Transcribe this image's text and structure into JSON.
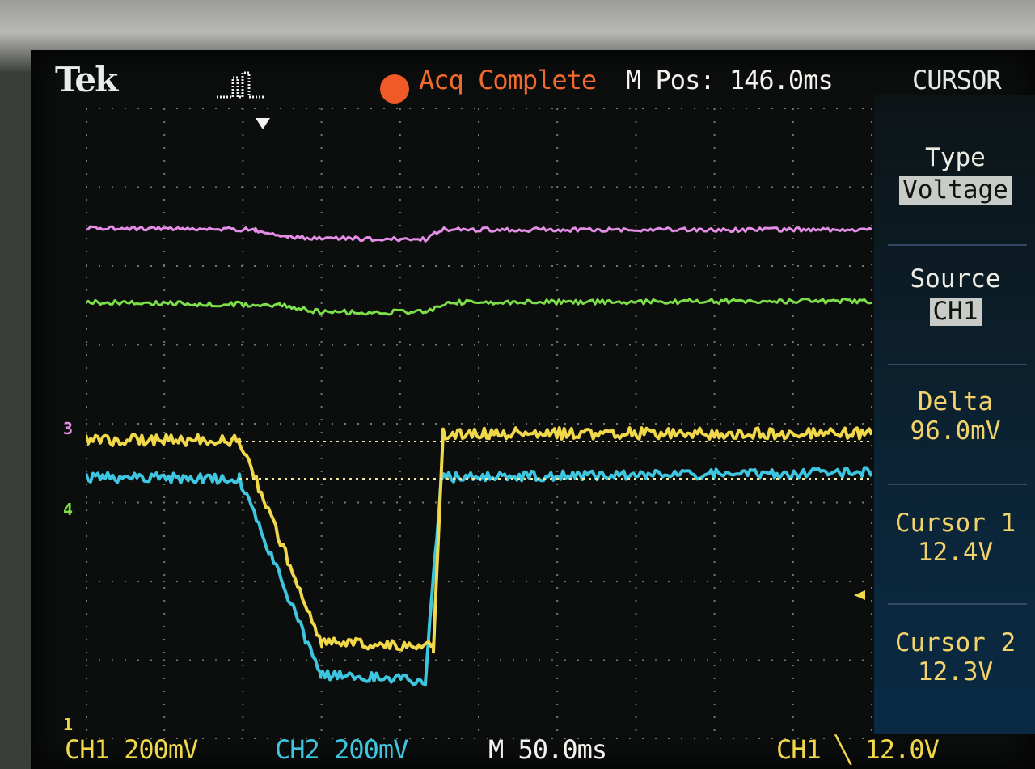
{
  "header": {
    "brand": "Tek",
    "status": "Acq Complete",
    "position": "M Pos: 146.0ms",
    "menu_title": "CURSOR"
  },
  "side_menu": {
    "type_label": "Type",
    "type_value": "Voltage",
    "source_label": "Source",
    "source_value": "CH1",
    "delta_label": "Delta",
    "delta_value": "96.0mV",
    "cursor1_label": "Cursor 1",
    "cursor1_value": "12.4V",
    "cursor2_label": "Cursor 2",
    "cursor2_value": "12.3V"
  },
  "footer": {
    "ch1_scale": "CH1  200mV",
    "ch2_scale": "CH2  200mV",
    "timebase": "M 50.0ms",
    "trigger": "CH1 ╲ 12.0V"
  },
  "markers": {
    "ch3": "3",
    "ch4": "4",
    "ch1": "1"
  },
  "colors": {
    "ch1": "#f0d84a",
    "ch2": "#3ec6e0",
    "ch3": "#e48ee8",
    "ch4": "#7de04a",
    "accent": "#f26a2f"
  }
}
